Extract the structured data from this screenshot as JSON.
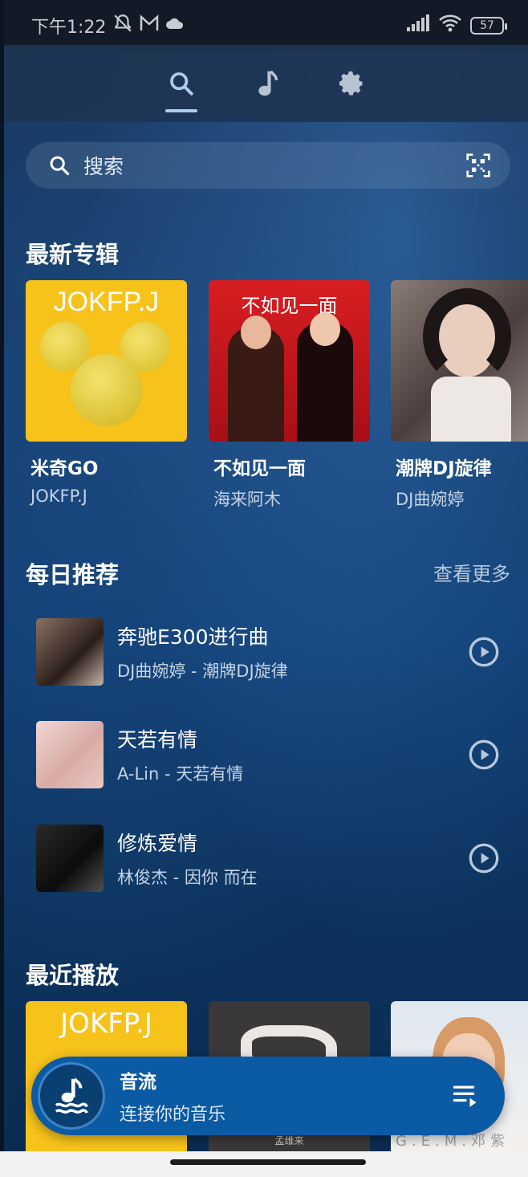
{
  "status": {
    "time": "下午1:22",
    "battery": "57"
  },
  "search": {
    "placeholder": "搜索"
  },
  "sections": {
    "new_albums": "最新专辑",
    "daily": "每日推荐",
    "see_more": "查看更多",
    "recent": "最近播放"
  },
  "albums": [
    {
      "title": "米奇GO",
      "artist": "JOKFP.J",
      "cover_text": "JOKFP.J"
    },
    {
      "title": "不如见一面",
      "artist": "海来阿木",
      "cover_text": "不如见一面"
    },
    {
      "title": "潮牌DJ旋律",
      "artist": "DJ曲婉婷"
    }
  ],
  "recommend": [
    {
      "title": "奔驰E300进行曲",
      "subtitle": "DJ曲婉婷 - 潮牌DJ旋律"
    },
    {
      "title": "天若有情",
      "subtitle": "A-Lin - 天若有情"
    },
    {
      "title": "修炼爱情",
      "subtitle": "林俊杰 - 因你 而在"
    }
  ],
  "recent": [
    {
      "cover_text": "JOKFP.J"
    },
    {
      "cover_text": "孟维来"
    },
    {
      "cover_text": "G.E.M.邓紫"
    }
  ],
  "player": {
    "title": "音流",
    "subtitle": "连接你的音乐"
  },
  "colors": {
    "accent": "#0b5aa4",
    "background": "#0d3a6f",
    "yellow": "#f7c21a",
    "red": "#c8141c"
  }
}
